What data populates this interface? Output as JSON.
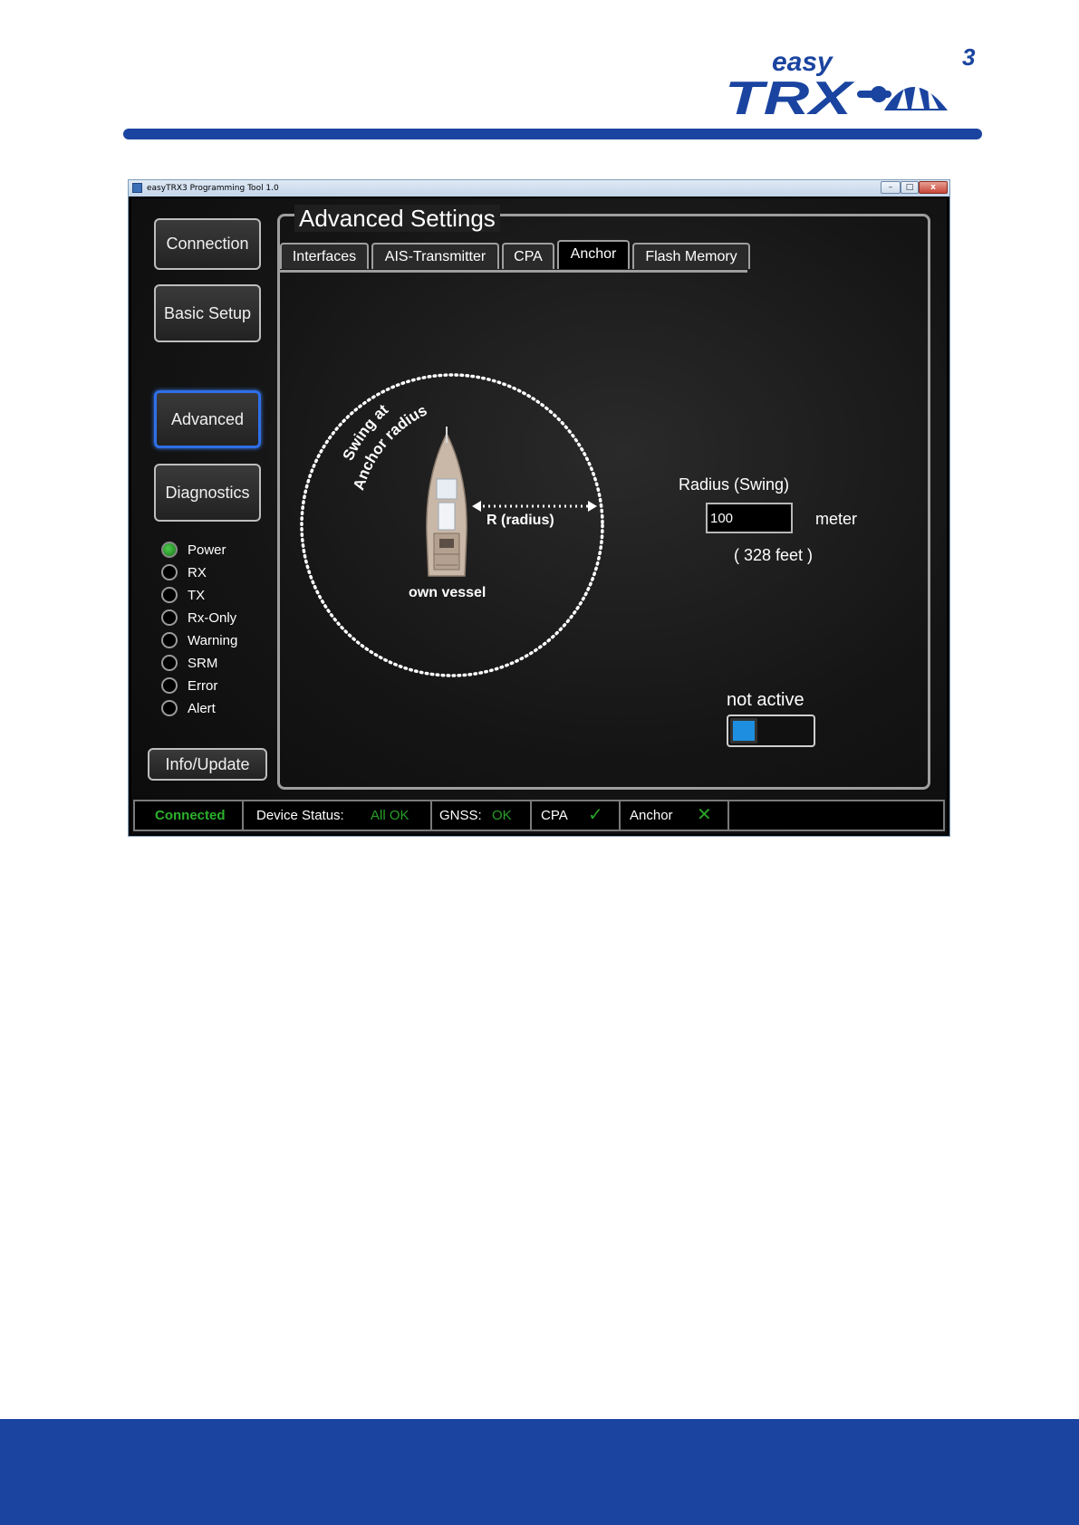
{
  "brand": {
    "logo_word_top": "easy",
    "logo_word_main": "TRX",
    "logo_superscript": "3",
    "primary_color": "#1a44a0"
  },
  "window": {
    "title": "easyTRX3 Programming Tool 1.0"
  },
  "nav": {
    "connection": "Connection",
    "basic_setup": "Basic Setup",
    "advanced": "Advanced",
    "diagnostics": "Diagnostics",
    "info_update": "Info/Update"
  },
  "leds": [
    {
      "label": "Power",
      "on": true
    },
    {
      "label": "RX",
      "on": false
    },
    {
      "label": "TX",
      "on": false
    },
    {
      "label": "Rx-Only",
      "on": false
    },
    {
      "label": "Warning",
      "on": false
    },
    {
      "label": "SRM",
      "on": false
    },
    {
      "label": "Error",
      "on": false
    },
    {
      "label": "Alert",
      "on": false
    }
  ],
  "panel": {
    "title": "Advanced Settings",
    "tabs": [
      "Interfaces",
      "AIS-Transmitter",
      "CPA",
      "Anchor",
      "Flash Memory"
    ],
    "active_tab": "Anchor"
  },
  "anchor": {
    "diagram_arc_line1": "Swing at",
    "diagram_arc_line2": "Anchor radius",
    "diagram_radius": "R (radius)",
    "diagram_vessel": "own vessel",
    "radius_label": "Radius (Swing)",
    "radius_value": "100",
    "unit": "meter",
    "feet": "( 328 feet )",
    "state_label": "not active",
    "toggle_color": "#1e8fe0"
  },
  "status": {
    "connected": "Connected",
    "device_status_label": "Device Status:",
    "device_status_value": "All OK",
    "gnss_label": "GNSS:",
    "gnss_value": "OK",
    "cpa_label": "CPA",
    "cpa_mark": "✓",
    "anchor_label": "Anchor",
    "anchor_mark": "✕"
  }
}
